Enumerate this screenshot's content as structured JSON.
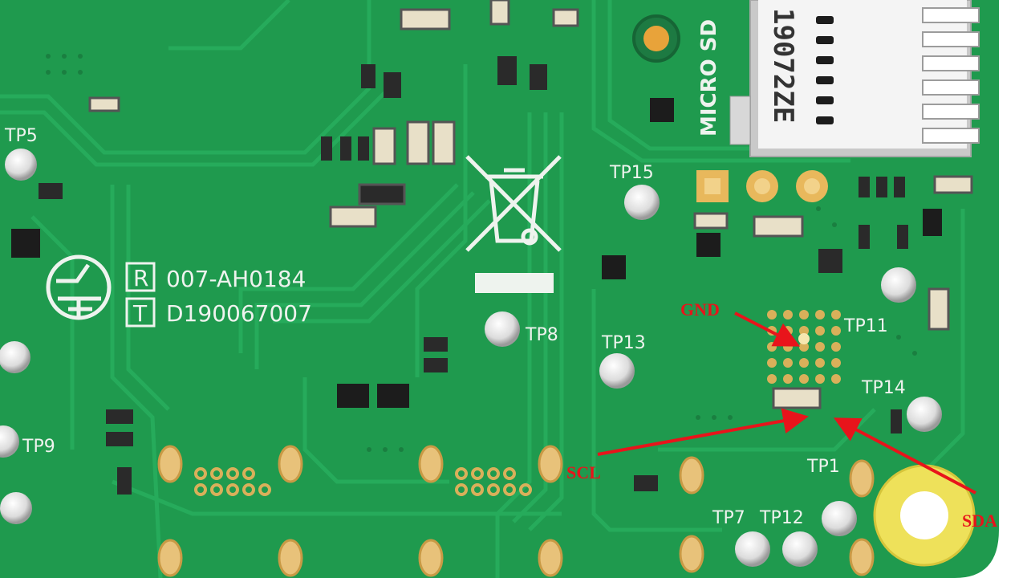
{
  "board": {
    "color": "#1f9a4e",
    "trace_color": "#25a95a",
    "silkscreen_color": "#eef3ee"
  },
  "silkscreen": {
    "cert_r_letter": "R",
    "cert_r_code": "007-AH0184",
    "cert_t_letter": "T",
    "cert_t_code": "D190067007",
    "sd_slot_label": "MICRO SD",
    "sd_part_number": "19072ZE",
    "test_points": [
      "TP5",
      "TP9",
      "TP15",
      "TP8",
      "TP13",
      "TP11",
      "TP14",
      "TP1",
      "TP7",
      "TP12"
    ]
  },
  "annotations": {
    "color": "#e8141b",
    "gnd": "GND",
    "scl": "SCL",
    "sda": "SDA"
  }
}
